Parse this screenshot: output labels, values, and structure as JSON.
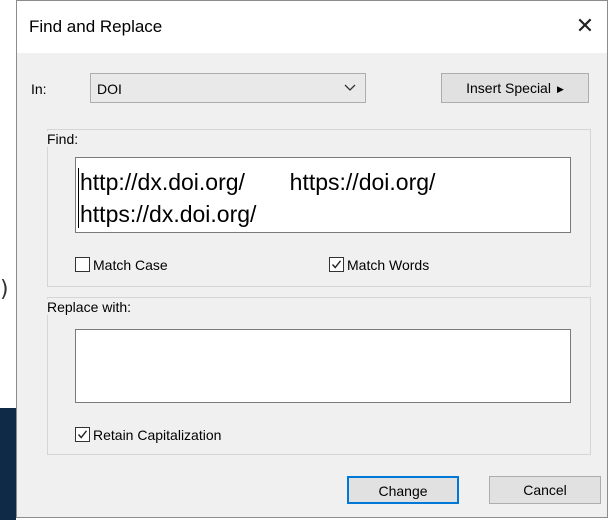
{
  "background": {
    "paren_text": ")",
    "block_color": "#0f2a47"
  },
  "dialog": {
    "title": "Find and Replace",
    "close_icon": "close-icon"
  },
  "in_field": {
    "label": "In:",
    "value": "DOI",
    "icon": "chevron-down-icon"
  },
  "insert_special": {
    "label": "Insert Special",
    "icon": "triangle-right-icon"
  },
  "find": {
    "group_label": "Find:",
    "value": "http://dx.doi.org/       https://doi.org/ https://dx.doi.org/",
    "match_case": {
      "label": "Match Case",
      "checked": false
    },
    "match_words": {
      "label": "Match Words",
      "checked": true
    }
  },
  "replace": {
    "group_label": "Replace with:",
    "value": "",
    "retain_capitalization": {
      "label": "Retain Capitalization",
      "checked": true
    }
  },
  "buttons": {
    "change": "Change",
    "cancel": "Cancel"
  },
  "colors": {
    "focus_border": "#0078d7",
    "dialog_bg": "#f0f0f0"
  }
}
